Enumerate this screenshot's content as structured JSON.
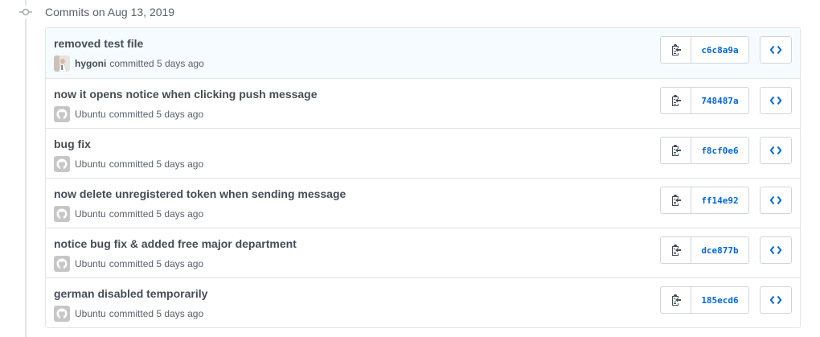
{
  "group": {
    "title": "Commits on Aug 13, 2019"
  },
  "colors": {
    "link": "#0366d6",
    "border": "#e1e4e8",
    "muted": "#586069",
    "highlight_row": "#f6fbff"
  },
  "icons": {
    "timeline": "git-commit-icon",
    "copy": "clipboard-icon",
    "browse": "code-icon",
    "avatar_default": "github-octocat-icon"
  },
  "commits": [
    {
      "message": "removed test file",
      "author": "hygoni",
      "action": "committed",
      "time": "5 days ago",
      "sha": "c6c8a9a",
      "avatar": "user-photo"
    },
    {
      "message": "now it opens notice when clicking push message",
      "author": "Ubuntu",
      "action": "committed",
      "time": "5 days ago",
      "sha": "748487a",
      "avatar": "github-octocat-icon"
    },
    {
      "message": "bug fix",
      "author": "Ubuntu",
      "action": "committed",
      "time": "5 days ago",
      "sha": "f8cf0e6",
      "avatar": "github-octocat-icon"
    },
    {
      "message": "now delete unregistered token when sending message",
      "author": "Ubuntu",
      "action": "committed",
      "time": "5 days ago",
      "sha": "ff14e92",
      "avatar": "github-octocat-icon"
    },
    {
      "message": "notice bug fix & added free major department",
      "author": "Ubuntu",
      "action": "committed",
      "time": "5 days ago",
      "sha": "dce877b",
      "avatar": "github-octocat-icon"
    },
    {
      "message": "german disabled temporarily",
      "author": "Ubuntu",
      "action": "committed",
      "time": "5 days ago",
      "sha": "185ecd6",
      "avatar": "github-octocat-icon"
    }
  ]
}
